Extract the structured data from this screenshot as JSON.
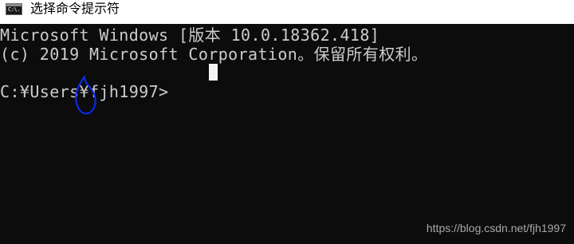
{
  "window": {
    "title": "选择命令提示符",
    "icon": "cmd-icon",
    "icon_glyph": "C:\\."
  },
  "console": {
    "lines": [
      "Microsoft Windows [版本 10.0.18362.418]",
      "(c) 2019 Microsoft Corporation。保留所有权利。"
    ],
    "prompt": "C:¥Users¥fjh1997>"
  },
  "annotation": {
    "color": "#0a2cff",
    "shape": "hand-drawn-circle"
  },
  "watermark": "https://blog.csdn.net/fjh1997",
  "colors": {
    "console_bg": "#0c0c0c",
    "console_text": "#cccccc",
    "titlebar_bg": "#ffffff"
  }
}
